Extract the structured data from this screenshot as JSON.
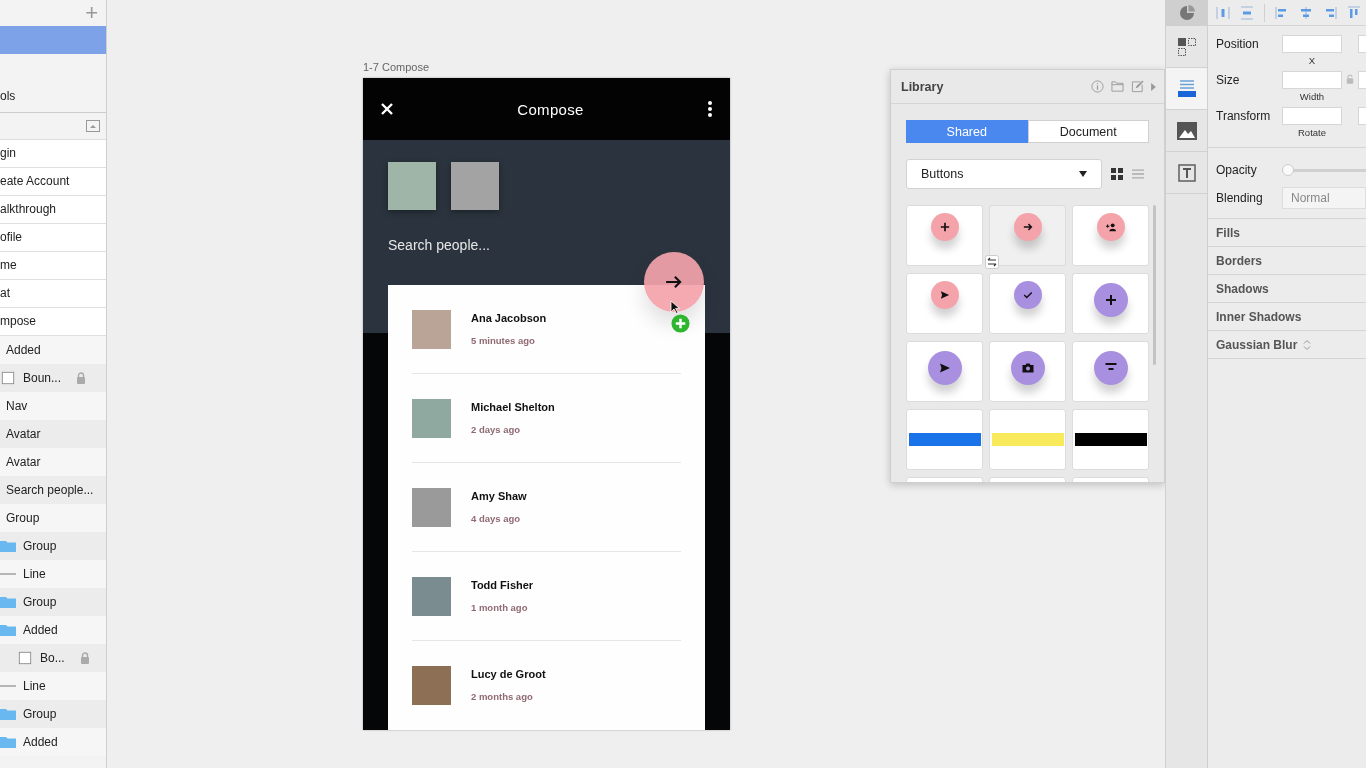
{
  "add_page": "+",
  "pages": [
    {
      "selected": true
    },
    {
      "label": "ols",
      "selected": false
    }
  ],
  "artboards": [
    "gin",
    "eate Account",
    "alkthrough",
    "ofile",
    "me",
    "at",
    "mpose"
  ],
  "layers": [
    {
      "label": "Added",
      "kind": "plain",
      "locked": false,
      "children": [
        {
          "label": "Boun...",
          "kind": "box",
          "locked": true
        }
      ]
    },
    {
      "label": "Nav",
      "kind": "plain",
      "locked": false
    },
    {
      "label": "Avatar",
      "kind": "plain",
      "locked": false
    },
    {
      "label": "Avatar",
      "kind": "plain",
      "locked": false
    },
    {
      "label": "Search people...",
      "kind": "plain",
      "locked": false
    },
    {
      "label": "Group",
      "kind": "plain",
      "locked": false,
      "children": [
        {
          "label": "Group",
          "kind": "group",
          "locked": false
        },
        {
          "label": "Line",
          "kind": "line",
          "locked": false
        },
        {
          "label": "Group",
          "kind": "group",
          "locked": false
        },
        {
          "label": "Added",
          "kind": "group",
          "locked": false,
          "children": [
            {
              "label": "Bo...",
              "kind": "box",
              "locked": true
            }
          ]
        },
        {
          "label": "Line",
          "kind": "line",
          "locked": false
        },
        {
          "label": "Group",
          "kind": "group",
          "locked": false
        },
        {
          "label": "Added",
          "kind": "group",
          "locked": false
        }
      ]
    }
  ],
  "artboard": {
    "label": "1-7 Compose",
    "title": "Compose",
    "search_placeholder": "Search people...",
    "contacts": [
      {
        "name": "Ana Jacobson",
        "time": "5 minutes ago"
      },
      {
        "name": "Michael Shelton",
        "time": "2 days ago"
      },
      {
        "name": "Amy Shaw",
        "time": "4 days ago"
      },
      {
        "name": "Todd Fisher",
        "time": "1 month ago"
      },
      {
        "name": "Lucy de Groot",
        "time": "2 months ago"
      }
    ]
  },
  "library": {
    "title": "Library",
    "tabs": [
      {
        "label": "Shared",
        "selected": true
      },
      {
        "label": "Document",
        "selected": false
      }
    ],
    "dropdown": "Buttons",
    "grid_view": true,
    "tiles": [
      {
        "kind": "round",
        "color": "#f4a3ab",
        "large": false,
        "hovered": false
      },
      {
        "kind": "round",
        "color": "#f4a3ab",
        "large": false,
        "hovered": true
      },
      {
        "kind": "round",
        "color": "#f4a3ab",
        "large": false,
        "hovered": false
      },
      {
        "kind": "round",
        "color": "#f4a3ab",
        "large": false,
        "hovered": false
      },
      {
        "kind": "round",
        "color": "#a98fe0",
        "large": false,
        "hovered": false
      },
      {
        "kind": "round",
        "color": "#a98fe0",
        "large": true,
        "hovered": false
      },
      {
        "kind": "round",
        "color": "#a98fe0",
        "large": true,
        "hovered": false
      },
      {
        "kind": "round",
        "color": "#a98fe0",
        "large": true,
        "hovered": false
      },
      {
        "kind": "round",
        "color": "#a98fe0",
        "large": true,
        "hovered": false
      },
      {
        "kind": "bar",
        "color": "#1a73e8",
        "hovered": false
      },
      {
        "kind": "bar",
        "color": "#f8ea5a",
        "hovered": false
      },
      {
        "kind": "bar",
        "color": "#000000",
        "hovered": false
      },
      {
        "kind": "blank",
        "hovered": false
      },
      {
        "kind": "blank",
        "hovered": false
      },
      {
        "kind": "blank",
        "hovered": false
      }
    ]
  },
  "inspector": {
    "rows": [
      {
        "label": "Position",
        "sublabel": "X",
        "lock": false
      },
      {
        "label": "Size",
        "sublabel": "Width",
        "lock": true
      },
      {
        "label": "Transform",
        "sublabel": "Rotate",
        "lock": false
      }
    ],
    "opacity": {
      "label": "Opacity",
      "level": 0
    },
    "blending": {
      "label": "Blending",
      "value": "Normal"
    },
    "sections": [
      {
        "label": "Fills",
        "stepper": false
      },
      {
        "label": "Borders",
        "stepper": false
      },
      {
        "label": "Shadows",
        "stepper": false
      },
      {
        "label": "Inner Shadows",
        "stepper": false
      },
      {
        "label": "Gaussian Blur",
        "stepper": true
      }
    ]
  }
}
